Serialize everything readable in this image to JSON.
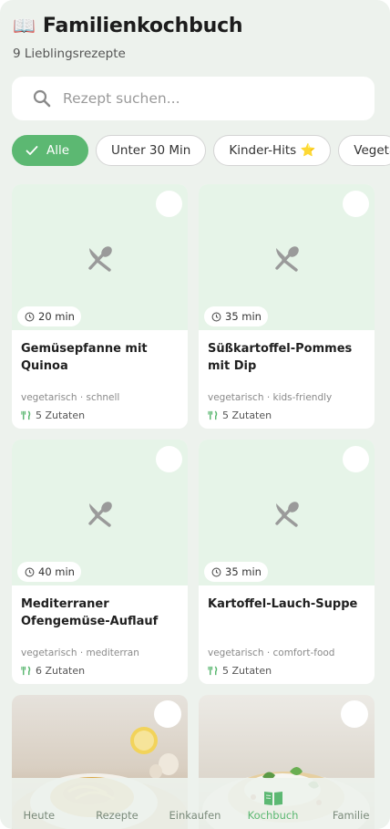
{
  "header": {
    "emoji": "📖",
    "title": "Familienkochbuch",
    "subtitle": "9 Lieblingsrezepte"
  },
  "search": {
    "placeholder": "Rezept suchen...",
    "value": ""
  },
  "filters": [
    {
      "label": "Alle",
      "active": true
    },
    {
      "label": "Unter 30 Min",
      "active": false
    },
    {
      "label": "Kinder-Hits ⭐",
      "active": false
    },
    {
      "label": "Vegeta",
      "active": false
    }
  ],
  "recipes": [
    {
      "time": "20 min",
      "title": "Gemüsepfanne mit Quinoa",
      "tags": "vegetarisch · schnell",
      "ingredients": "5 Zutaten"
    },
    {
      "time": "35 min",
      "title": "Süßkartoffel-Pommes mit Dip",
      "tags": "vegetarisch · kids-friendly",
      "ingredients": "5 Zutaten"
    },
    {
      "time": "40 min",
      "title": "Mediterraner Ofengemüse-Auflauf",
      "tags": "vegetarisch · mediterran",
      "ingredients": "6 Zutaten"
    },
    {
      "time": "35 min",
      "title": "Kartoffel-Lauch-Suppe",
      "tags": "vegetarisch · comfort-food",
      "ingredients": "5 Zutaten"
    }
  ],
  "nav": [
    {
      "label": "Heute",
      "icon": "sun-icon",
      "active": false
    },
    {
      "label": "Rezepte",
      "icon": "recipes-icon",
      "active": false
    },
    {
      "label": "Einkaufen",
      "icon": "cart-icon",
      "active": false
    },
    {
      "label": "Kochbuch",
      "icon": "book-icon",
      "active": true
    },
    {
      "label": "Familie",
      "icon": "family-icon",
      "active": false
    }
  ],
  "colors": {
    "accent": "#5cb872",
    "card_placeholder": "#e6f4e8",
    "background": "#edf2ed"
  }
}
